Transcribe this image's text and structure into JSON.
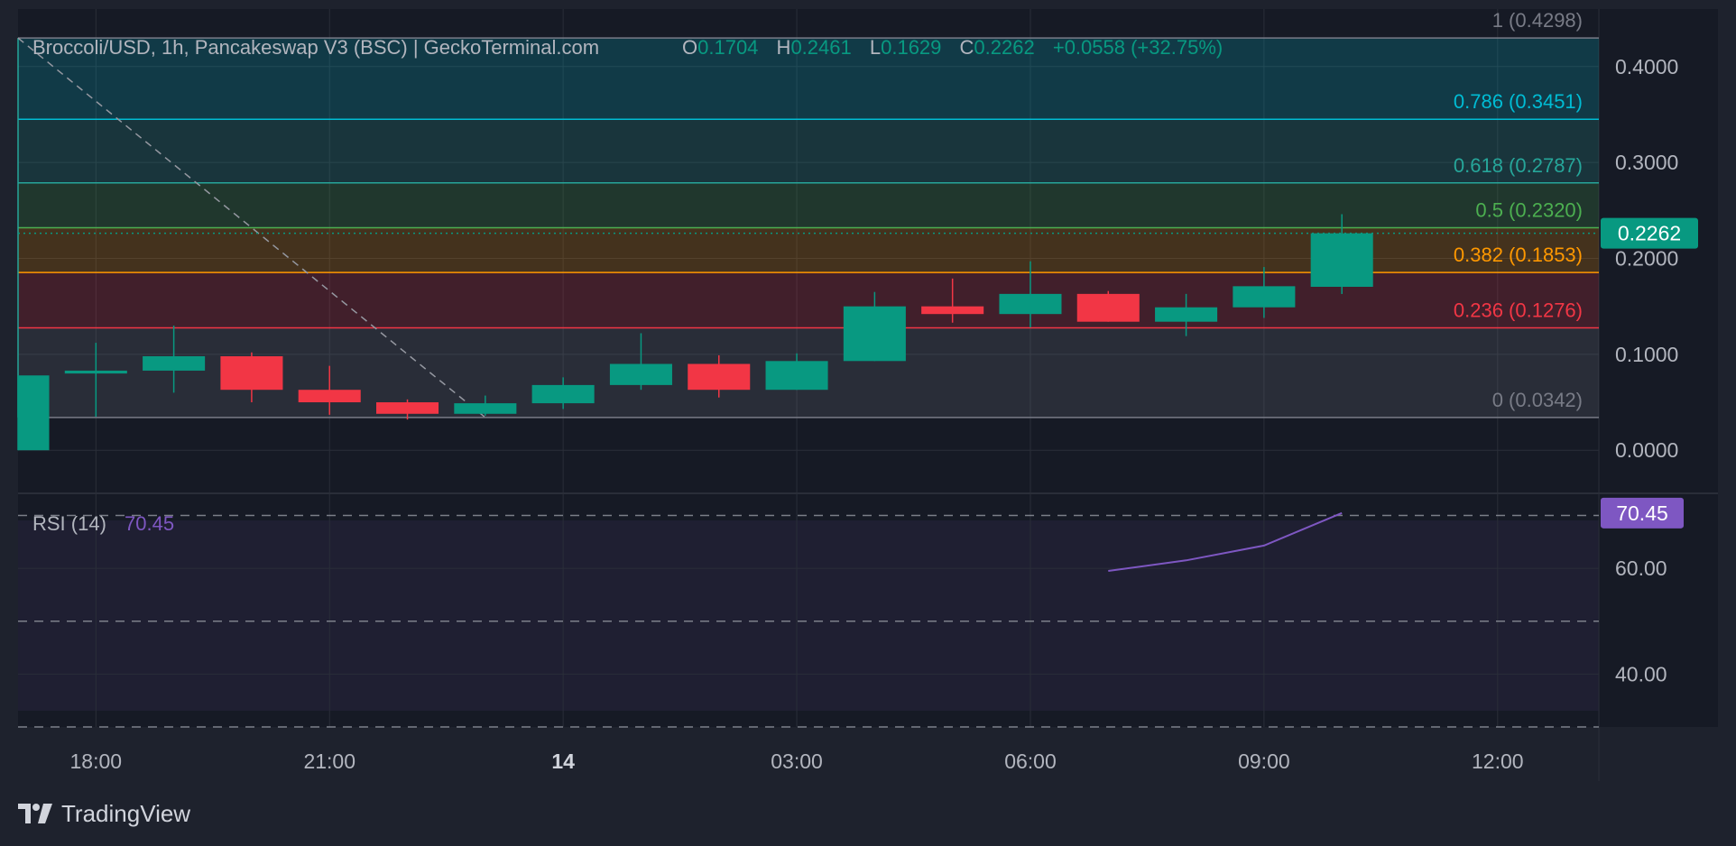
{
  "header": {
    "title": "Broccoli/USD, 1h, Pancakeswap V3 (BSC) | GeckoTerminal.com",
    "open_label": "O",
    "open_value": "0.1704",
    "high_label": "H",
    "high_value": "0.2461",
    "low_label": "L",
    "low_value": "0.1629",
    "close_label": "C",
    "close_value": "0.2262",
    "change": "+0.0558 (+32.75%)"
  },
  "brand": {
    "name": "TradingView"
  },
  "colors": {
    "background": "#1e222d",
    "pane": "#161a25",
    "grid": "#2a2e39",
    "up": "#089981",
    "down": "#f23645",
    "rsi": "#7e57c2",
    "text": "#b2b5be"
  },
  "chart_data": [
    {
      "type": "candlestick",
      "title": "Broccoli/USD, 1h, Pancakeswap V3 (BSC) | GeckoTerminal.com",
      "x_ticks": [
        "18:00",
        "21:00",
        "14",
        "03:00",
        "06:00",
        "09:00",
        "12:00"
      ],
      "x_tick_hours": [
        18,
        21,
        24,
        27,
        30,
        33,
        36
      ],
      "y_ticks": [
        "0.0000",
        "0.1000",
        "0.2000",
        "0.3000",
        "0.4000"
      ],
      "ylim": [
        -0.044,
        0.46
      ],
      "xlim": [
        17,
        37.3
      ],
      "current_price": "0.2262",
      "grid": true,
      "candles": [
        {
          "t": 17,
          "o": 0.0,
          "h": 0.078,
          "l": 0.0,
          "c": 0.078
        },
        {
          "t": 18,
          "o": 0.08,
          "h": 0.112,
          "l": 0.035,
          "c": 0.083
        },
        {
          "t": 19,
          "o": 0.083,
          "h": 0.13,
          "l": 0.06,
          "c": 0.098
        },
        {
          "t": 20,
          "o": 0.098,
          "h": 0.102,
          "l": 0.05,
          "c": 0.063
        },
        {
          "t": 21,
          "o": 0.063,
          "h": 0.088,
          "l": 0.037,
          "c": 0.05
        },
        {
          "t": 22,
          "o": 0.05,
          "h": 0.053,
          "l": 0.032,
          "c": 0.038
        },
        {
          "t": 23,
          "o": 0.038,
          "h": 0.057,
          "l": 0.036,
          "c": 0.049
        },
        {
          "t": 24,
          "o": 0.049,
          "h": 0.076,
          "l": 0.043,
          "c": 0.068
        },
        {
          "t": 25,
          "o": 0.068,
          "h": 0.122,
          "l": 0.063,
          "c": 0.09
        },
        {
          "t": 26,
          "o": 0.09,
          "h": 0.099,
          "l": 0.055,
          "c": 0.063
        },
        {
          "t": 27,
          "o": 0.063,
          "h": 0.101,
          "l": 0.063,
          "c": 0.093
        },
        {
          "t": 28,
          "o": 0.093,
          "h": 0.165,
          "l": 0.093,
          "c": 0.15
        },
        {
          "t": 29,
          "o": 0.15,
          "h": 0.179,
          "l": 0.133,
          "c": 0.142
        },
        {
          "t": 30,
          "o": 0.142,
          "h": 0.197,
          "l": 0.128,
          "c": 0.163
        },
        {
          "t": 31,
          "o": 0.163,
          "h": 0.166,
          "l": 0.134,
          "c": 0.134
        },
        {
          "t": 32,
          "o": 0.134,
          "h": 0.163,
          "l": 0.119,
          "c": 0.149
        },
        {
          "t": 33,
          "o": 0.149,
          "h": 0.191,
          "l": 0.138,
          "c": 0.171
        },
        {
          "t": 34,
          "o": 0.1704,
          "h": 0.2461,
          "l": 0.1629,
          "c": 0.2262
        }
      ],
      "fibonacci": [
        {
          "label": "1 (0.4298)",
          "value": 0.4298,
          "color": "#787b86"
        },
        {
          "label": "0.786 (0.3451)",
          "value": 0.3451,
          "color": "#00bcd4"
        },
        {
          "label": "0.618 (0.2787)",
          "value": 0.2787,
          "color": "#26a69a"
        },
        {
          "label": "0.5 (0.2320)",
          "value": 0.232,
          "color": "#4caf50"
        },
        {
          "label": "0.382 (0.1853)",
          "value": 0.1853,
          "color": "#ff9800"
        },
        {
          "label": "0.236 (0.1276)",
          "value": 0.1276,
          "color": "#f23645"
        },
        {
          "label": "0 (0.0342)",
          "value": 0.0342,
          "color": "#787b86"
        }
      ],
      "trend_line": {
        "from": {
          "t": 17,
          "v": 0.4298
        },
        "to": {
          "t": 23,
          "v": 0.0342
        }
      }
    },
    {
      "type": "line",
      "name": "RSI (14)",
      "last_value": "70.45",
      "y_ticks": [
        "40.00",
        "60.00"
      ],
      "ylim": [
        30,
        74
      ],
      "reference_levels": [
        30,
        50,
        70
      ],
      "x": [
        31,
        32,
        33,
        34
      ],
      "values": [
        59.5,
        61.5,
        64.3,
        70.45
      ]
    }
  ]
}
